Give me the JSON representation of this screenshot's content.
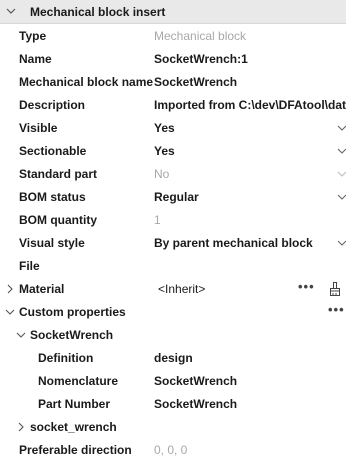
{
  "header": {
    "title": "Mechanical block insert"
  },
  "rows": {
    "type": {
      "label": "Type",
      "value": "Mechanical block"
    },
    "name": {
      "label": "Name",
      "value": "SocketWrench:1"
    },
    "block_name": {
      "label": "Mechanical block name",
      "value": "SocketWrench"
    },
    "description": {
      "label": "Description",
      "value": "Imported from C:\\dev\\DFAtool\\data\\To"
    },
    "visible": {
      "label": "Visible",
      "value": "Yes"
    },
    "sectionable": {
      "label": "Sectionable",
      "value": "Yes"
    },
    "standard_part": {
      "label": "Standard part",
      "value": "No"
    },
    "bom_status": {
      "label": "BOM status",
      "value": "Regular"
    },
    "bom_quantity": {
      "label": "BOM quantity",
      "value": "1"
    },
    "visual_style": {
      "label": "Visual style",
      "value": "By parent mechanical block"
    },
    "file": {
      "label": "File",
      "value": ""
    },
    "material": {
      "label": "Material",
      "value": "<Inherit>"
    }
  },
  "custom": {
    "label": "Custom properties",
    "group": {
      "label": "SocketWrench",
      "items": [
        {
          "label": "Definition",
          "value": "design"
        },
        {
          "label": "Nomenclature",
          "value": "SocketWrench"
        },
        {
          "label": "Part Number",
          "value": "SocketWrench"
        }
      ]
    },
    "subgroup": {
      "label": "socket_wrench"
    }
  },
  "preferable_direction": {
    "label": "Preferable direction",
    "value": "0, 0, 0"
  },
  "glyphs": {
    "more": "•••"
  },
  "icons": {
    "collapse": "chevron-down-icon",
    "expand": "chevron-right-icon",
    "dropdown": "dropdown-arrow-icon",
    "more": "more-options-icon",
    "brush": "paint-brush-icon"
  }
}
